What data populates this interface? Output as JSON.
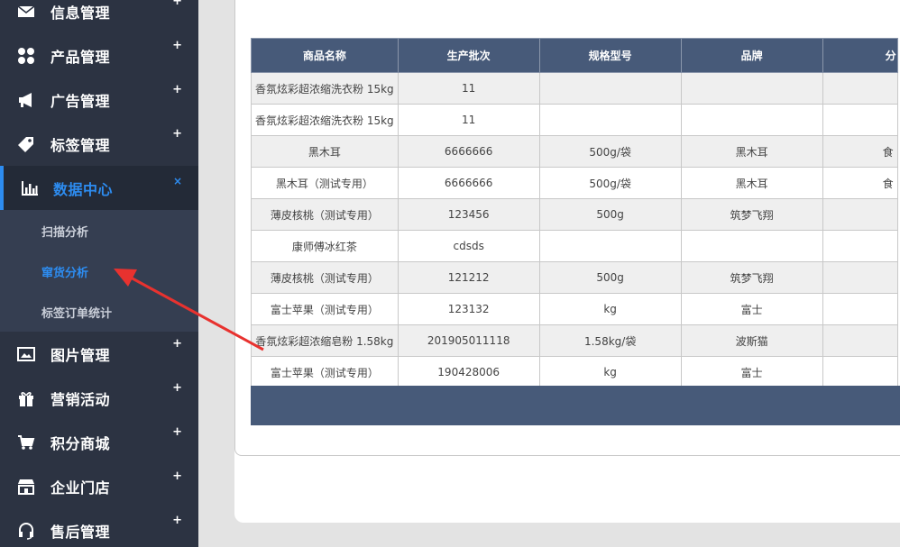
{
  "sidebar": {
    "items": [
      {
        "label": "信息管理",
        "icon": "envelope-icon",
        "toggle": "+"
      },
      {
        "label": "产品管理",
        "icon": "grid-icon",
        "toggle": "+"
      },
      {
        "label": "广告管理",
        "icon": "megaphone-icon",
        "toggle": "+"
      },
      {
        "label": "标签管理",
        "icon": "tag-icon",
        "toggle": "+"
      },
      {
        "label": "数据中心",
        "icon": "bar-chart-icon",
        "toggle": "×"
      },
      {
        "label": "图片管理",
        "icon": "image-icon",
        "toggle": "+"
      },
      {
        "label": "营销活动",
        "icon": "gift-icon",
        "toggle": "+"
      },
      {
        "label": "积分商城",
        "icon": "cart-icon",
        "toggle": "+"
      },
      {
        "label": "企业门店",
        "icon": "store-icon",
        "toggle": "+"
      },
      {
        "label": "售后管理",
        "icon": "headset-icon",
        "toggle": "+"
      }
    ],
    "sub_items": [
      {
        "label": "扫描分析"
      },
      {
        "label": "窜货分析"
      },
      {
        "label": "标签订单统计"
      }
    ]
  },
  "table": {
    "headers": [
      "商品名称",
      "生产批次",
      "规格型号",
      "品牌",
      "分"
    ],
    "rows": [
      [
        "香氛炫彩超浓缩洗衣粉 15kg",
        "11",
        "",
        "",
        ""
      ],
      [
        "香氛炫彩超浓缩洗衣粉 15kg",
        "11",
        "",
        "",
        ""
      ],
      [
        "黑木耳",
        "6666666",
        "500g/袋",
        "黑木耳",
        "食"
      ],
      [
        "黑木耳（测试专用）",
        "6666666",
        "500g/袋",
        "黑木耳",
        "食"
      ],
      [
        "薄皮核桃（测试专用）",
        "123456",
        "500g",
        "筑梦飞翔",
        ""
      ],
      [
        "康师傅冰红茶",
        "cdsds",
        "",
        "",
        ""
      ],
      [
        "薄皮核桃（测试专用）",
        "121212",
        "500g",
        "筑梦飞翔",
        ""
      ],
      [
        "富士苹果（测试专用）",
        "123132",
        "kg",
        "富士",
        ""
      ],
      [
        "香氛炫彩超浓缩皂粉 1.58kg",
        "201905011118",
        "1.58kg/袋",
        "波斯猫",
        ""
      ],
      [
        "富士苹果（测试专用）",
        "190428006",
        "kg",
        "富士",
        ""
      ]
    ]
  },
  "colors": {
    "sidebar_bg": "#2c3342",
    "accent": "#2d8cf0",
    "table_header": "#475a79",
    "arrow": "#e8322f"
  }
}
